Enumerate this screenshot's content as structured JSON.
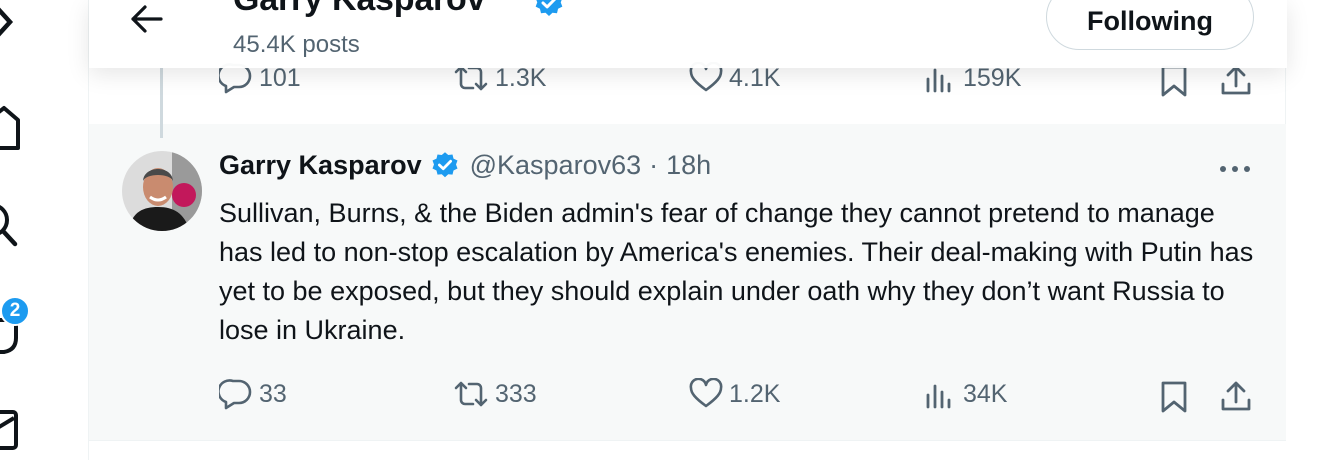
{
  "header": {
    "name": "Garry Kasparov",
    "posts_count": "45.4K posts",
    "follow_button_label": "Following"
  },
  "sidebar": {
    "icons": [
      "x-logo-icon",
      "home-icon",
      "explore-icon",
      "notifications-icon",
      "messages-icon"
    ],
    "notification_badge": "2"
  },
  "previous_tweet": {
    "replies": "101",
    "reposts": "1.3K",
    "likes": "4.1K",
    "views": "159K"
  },
  "tweet": {
    "author_name": "Garry Kasparov",
    "handle": "@Kasparov63",
    "separator": "·",
    "time": "18h",
    "text": "Sullivan, Burns, & the Biden admin's fear of change they cannot pretend to manage has led to non-stop escalation by America's enemies. Their deal-making with Putin has yet to be exposed, but they should explain under oath why they don’t want Russia to lose in Ukraine.",
    "replies": "33",
    "reposts": "333",
    "likes": "1.2K",
    "views": "34K"
  },
  "colors": {
    "accent": "#1d9bf0",
    "text_primary": "#0f1419",
    "text_secondary": "#536471",
    "tweet_background": "#f7f9f9",
    "border": "#cfd9de"
  }
}
